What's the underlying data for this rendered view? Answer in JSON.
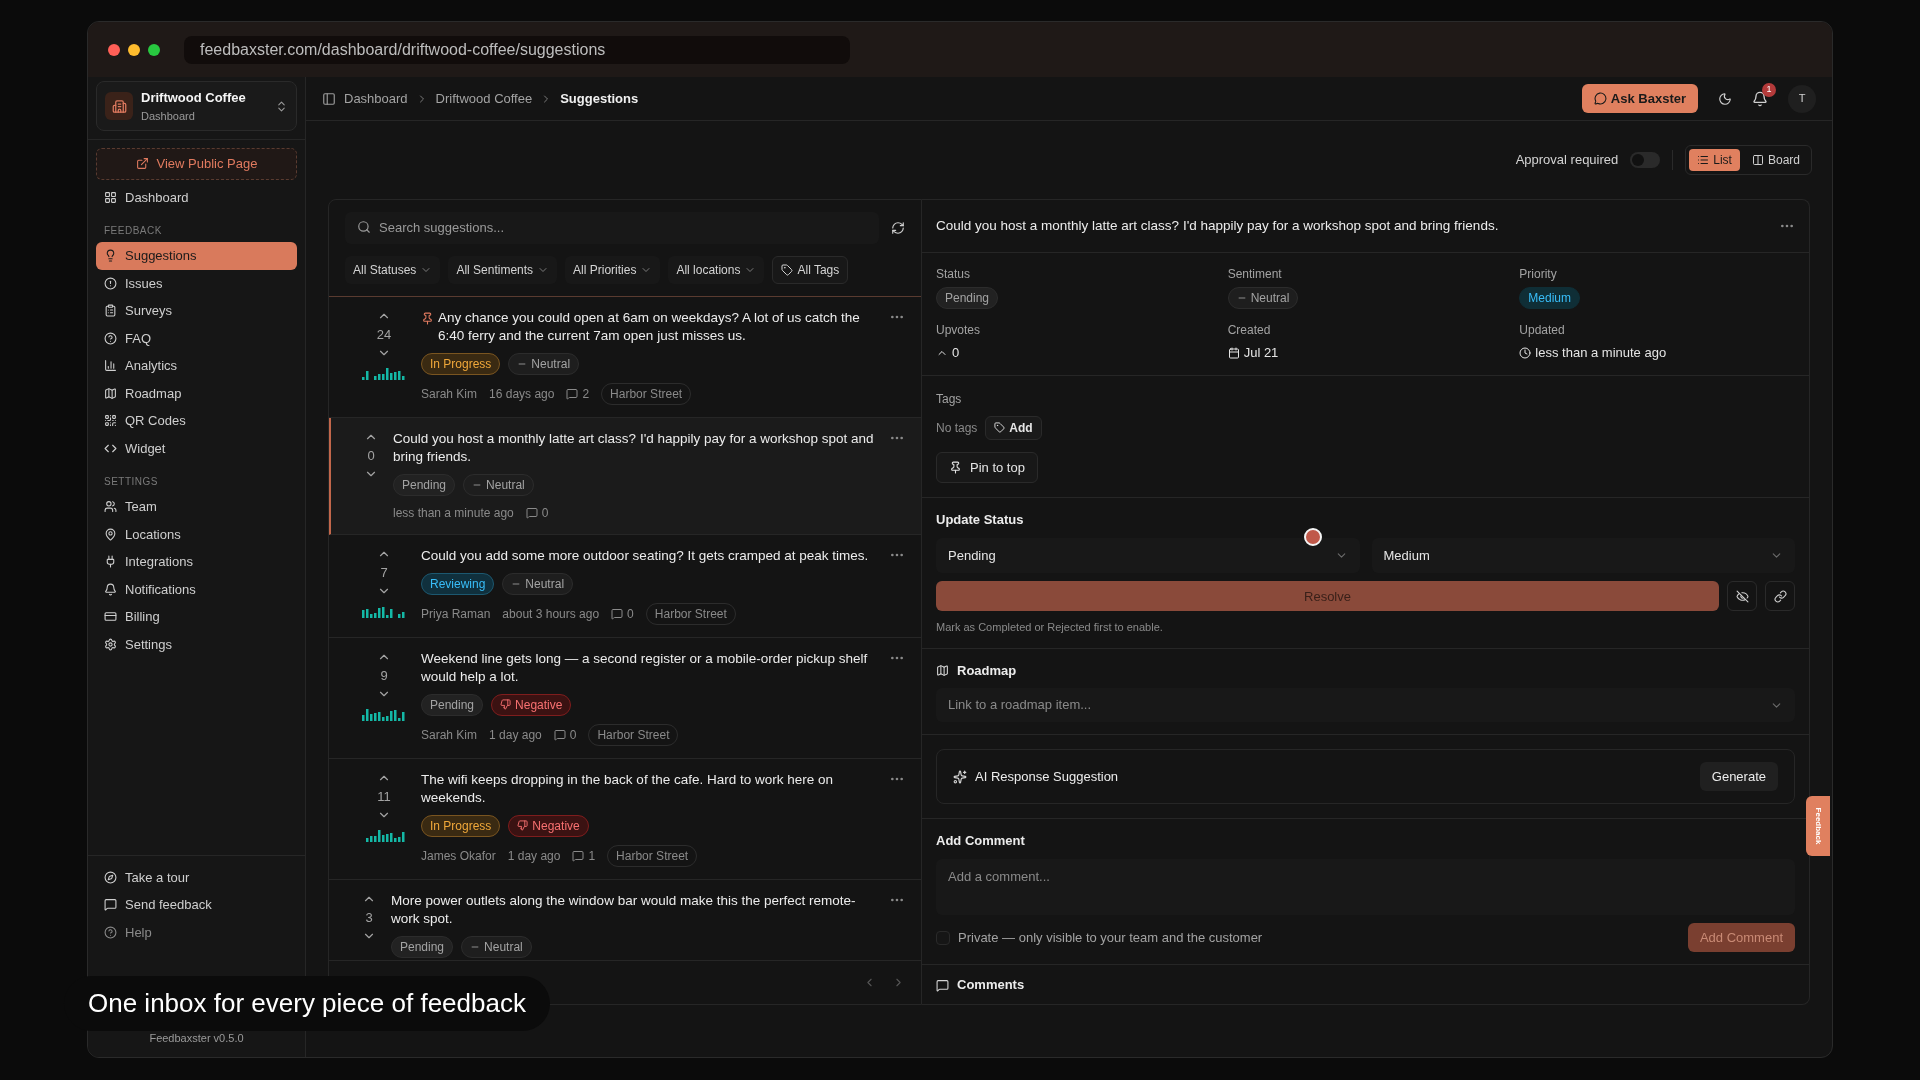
{
  "browser": {
    "url": "feedbaxster.com/dashboard/driftwood-coffee/suggestions"
  },
  "sidebar": {
    "workspace": {
      "name": "Driftwood Coffee",
      "subtitle": "Dashboard"
    },
    "public_page_button": "View Public Page",
    "sections": [
      {
        "items": [
          {
            "label": "Dashboard",
            "selected": false
          }
        ]
      },
      {
        "heading": "FEEDBACK",
        "items": [
          {
            "label": "Suggestions",
            "selected": true
          },
          {
            "label": "Issues",
            "selected": false
          },
          {
            "label": "Surveys",
            "selected": false
          },
          {
            "label": "FAQ",
            "selected": false
          },
          {
            "label": "Analytics",
            "selected": false
          },
          {
            "label": "Roadmap",
            "selected": false
          },
          {
            "label": "QR Codes",
            "selected": false
          },
          {
            "label": "Widget",
            "selected": false
          }
        ]
      },
      {
        "heading": "SETTINGS",
        "items": [
          {
            "label": "Team",
            "selected": false
          },
          {
            "label": "Locations",
            "selected": false
          },
          {
            "label": "Integrations",
            "selected": false
          },
          {
            "label": "Notifications",
            "selected": false
          },
          {
            "label": "Billing",
            "selected": false
          },
          {
            "label": "Settings",
            "selected": false
          }
        ]
      }
    ],
    "bottom_items": [
      "Take a tour",
      "Send feedback",
      "Help"
    ],
    "version": "Feedbaxster v0.5.0"
  },
  "header": {
    "breadcrumbs": [
      "Dashboard",
      "Driftwood Coffee",
      "Suggestions"
    ],
    "ask_button": "Ask Baxster",
    "notification_count": "1",
    "avatar": "T"
  },
  "toolbar": {
    "approval_label": "Approval required",
    "approval_on": false,
    "views": [
      {
        "label": "List",
        "selected": true
      },
      {
        "label": "Board",
        "selected": false
      }
    ]
  },
  "list": {
    "search_placeholder": "Search suggestions...",
    "filters": [
      "All Statuses",
      "All Sentiments",
      "All Priorities",
      "All locations"
    ],
    "tags_filter": "All Tags",
    "items": [
      {
        "votes": "24",
        "pinned": true,
        "selected": false,
        "activity_chart": true,
        "text": "Any chance you could open at 6am on weekdays? A lot of us catch the 6:40 ferry and the current 7am open just misses us.",
        "status": {
          "label": "In Progress",
          "kind": "in-progress"
        },
        "sentiment": {
          "label": "Neutral",
          "kind": "neutral"
        },
        "author": "Sarah Kim",
        "time": "16 days ago",
        "comments": "2",
        "location": "Harbor Street"
      },
      {
        "votes": "0",
        "pinned": false,
        "selected": true,
        "activity_chart": false,
        "text": "Could you host a monthly latte art class? I'd happily pay for a workshop spot and bring friends.",
        "status": {
          "label": "Pending",
          "kind": "pending"
        },
        "sentiment": {
          "label": "Neutral",
          "kind": "neutral"
        },
        "time": "less than a minute ago",
        "comments": "0"
      },
      {
        "votes": "7",
        "pinned": false,
        "selected": false,
        "activity_chart": true,
        "text": "Could you add some more outdoor seating? It gets cramped at peak times.",
        "status": {
          "label": "Reviewing",
          "kind": "reviewing"
        },
        "sentiment": {
          "label": "Neutral",
          "kind": "neutral"
        },
        "author": "Priya Raman",
        "time": "about 3 hours ago",
        "comments": "0",
        "location": "Harbor Street"
      },
      {
        "votes": "9",
        "pinned": false,
        "selected": false,
        "activity_chart": true,
        "text": "Weekend line gets long — a second register or a mobile-order pickup shelf would help a lot.",
        "status": {
          "label": "Pending",
          "kind": "pending"
        },
        "sentiment": {
          "label": "Negative",
          "kind": "negative"
        },
        "author": "Sarah Kim",
        "time": "1 day ago",
        "comments": "0",
        "location": "Harbor Street"
      },
      {
        "votes": "11",
        "pinned": false,
        "selected": false,
        "activity_chart": true,
        "text": "The wifi keeps dropping in the back of the cafe. Hard to work here on weekends.",
        "status": {
          "label": "In Progress",
          "kind": "in-progress"
        },
        "sentiment": {
          "label": "Negative",
          "kind": "negative"
        },
        "author": "James Okafor",
        "time": "1 day ago",
        "comments": "1",
        "location": "Harbor Street"
      },
      {
        "votes": "3",
        "pinned": false,
        "selected": false,
        "activity_chart": false,
        "text": "More power outlets along the window bar would make this the perfect remote-work spot.",
        "status": {
          "label": "Pending",
          "kind": "pending"
        },
        "sentiment": {
          "label": "Neutral",
          "kind": "neutral"
        }
      }
    ]
  },
  "detail": {
    "title": "Could you host a monthly latte art class? I'd happily pay for a workshop spot and bring friends.",
    "fields": [
      {
        "label": "Status",
        "value": "Pending",
        "kind": "pending"
      },
      {
        "label": "Sentiment",
        "value": "Neutral",
        "kind": "neutral"
      },
      {
        "label": "Priority",
        "value": "Medium",
        "kind": "medium"
      },
      {
        "label": "Upvotes",
        "value": "0",
        "kind": "upvotes"
      },
      {
        "label": "Created",
        "value": "Jul 21",
        "kind": "date"
      },
      {
        "label": "Updated",
        "value": "less than a minute ago",
        "kind": "time"
      }
    ],
    "tags_label": "Tags",
    "no_tags": "No tags",
    "add_tag": "Add",
    "pin_button": "Pin to top",
    "update_status": {
      "heading": "Update Status",
      "status": "Pending",
      "priority": "Medium",
      "resolve": "Resolve",
      "hint": "Mark as Completed or Rejected first to enable."
    },
    "roadmap": {
      "heading": "Roadmap",
      "placeholder": "Link to a roadmap item..."
    },
    "ai": {
      "heading": "AI Response Suggestion",
      "button": "Generate"
    },
    "comment": {
      "heading": "Add Comment",
      "placeholder": "Add a comment...",
      "private_label": "Private — only visible to your team and the customer",
      "private_checked": false,
      "button": "Add Comment"
    },
    "comments_heading": "Comments"
  },
  "feedback_tab": "Feedback",
  "caption": "One inbox for every piece of feedback"
}
